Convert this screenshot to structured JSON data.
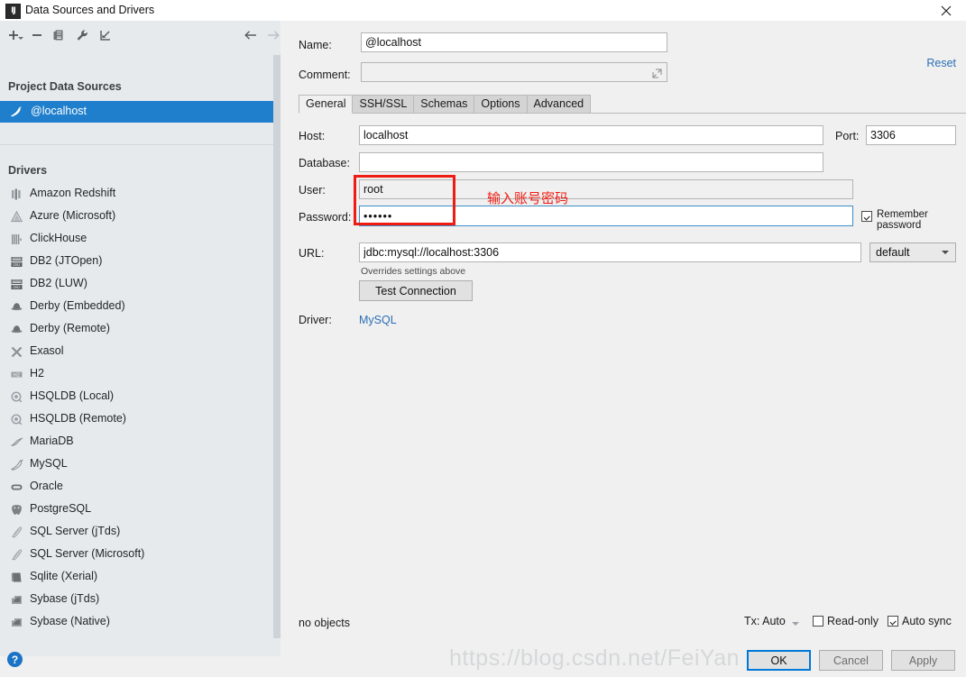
{
  "window": {
    "title": "Data Sources and Drivers",
    "icon": "intellij-idea-icon",
    "logo_text": "IJ",
    "close_label": "✕"
  },
  "toolbar": {
    "add": "add-icon",
    "remove": "remove-icon",
    "copy": "copy-icon",
    "settings": "wrench-icon",
    "import": "import-icon",
    "back": "arrow-left-icon",
    "forward": "arrow-right-icon"
  },
  "sidebar": {
    "project_group_label": "Project Data Sources",
    "datasources": [
      {
        "label": "@localhost",
        "icon": "mysql-icon",
        "selected": true
      }
    ],
    "drivers_group_label": "Drivers",
    "drivers": [
      {
        "label": "Amazon Redshift",
        "icon": "redshift-icon"
      },
      {
        "label": "Azure (Microsoft)",
        "icon": "azure-icon"
      },
      {
        "label": "ClickHouse",
        "icon": "clickhouse-icon"
      },
      {
        "label": "DB2 (JTOpen)",
        "icon": "db2-icon"
      },
      {
        "label": "DB2 (LUW)",
        "icon": "db2-icon"
      },
      {
        "label": "Derby (Embedded)",
        "icon": "derby-icon"
      },
      {
        "label": "Derby (Remote)",
        "icon": "derby-icon"
      },
      {
        "label": "Exasol",
        "icon": "exasol-icon"
      },
      {
        "label": "H2",
        "icon": "h2-icon"
      },
      {
        "label": "HSQLDB (Local)",
        "icon": "hsqldb-icon"
      },
      {
        "label": "HSQLDB (Remote)",
        "icon": "hsqldb-icon"
      },
      {
        "label": "MariaDB",
        "icon": "mariadb-icon"
      },
      {
        "label": "MySQL",
        "icon": "mysql-icon"
      },
      {
        "label": "Oracle",
        "icon": "oracle-icon"
      },
      {
        "label": "PostgreSQL",
        "icon": "postgresql-icon"
      },
      {
        "label": "SQL Server (jTds)",
        "icon": "sqlserver-icon"
      },
      {
        "label": "SQL Server (Microsoft)",
        "icon": "sqlserver-icon"
      },
      {
        "label": "Sqlite (Xerial)",
        "icon": "sqlite-icon"
      },
      {
        "label": "Sybase (jTds)",
        "icon": "sybase-icon"
      },
      {
        "label": "Sybase (Native)",
        "icon": "sybase-icon"
      }
    ]
  },
  "form": {
    "name_label": "Name:",
    "name_value": "@localhost",
    "comment_label": "Comment:",
    "comment_value": "",
    "reset_label": "Reset",
    "expand_icon": "expand-icon"
  },
  "tabs": [
    {
      "label": "General",
      "active": true
    },
    {
      "label": "SSH/SSL",
      "active": false
    },
    {
      "label": "Schemas",
      "active": false
    },
    {
      "label": "Options",
      "active": false
    },
    {
      "label": "Advanced",
      "active": false
    }
  ],
  "general": {
    "host_label": "Host:",
    "host_value": "localhost",
    "port_label": "Port:",
    "port_value": "3306",
    "database_label": "Database:",
    "database_value": "",
    "user_label": "User:",
    "user_value": "root",
    "password_label": "Password:",
    "password_value": "••••••",
    "remember_password_label": "Remember password",
    "remember_password_checked": true,
    "url_label": "URL:",
    "url_value": "jdbc:mysql://localhost:3306",
    "url_mode_value": "default",
    "overrides_hint": "Overrides settings above",
    "test_connection_label": "Test Connection",
    "driver_label": "Driver:",
    "driver_value": "MySQL"
  },
  "status": {
    "objects_text": "no objects",
    "tx_label": "Tx: Auto",
    "readonly_label": "Read-only",
    "readonly_checked": false,
    "autosync_label": "Auto sync",
    "autosync_checked": true
  },
  "footer": {
    "help_label": "?",
    "ok_label": "OK",
    "cancel_label": "Cancel",
    "apply_label": "Apply"
  },
  "annotation": {
    "text": "输入账号密码",
    "color": "#ee1c12"
  },
  "watermark": {
    "text": "https://blog.csdn.net/FeiYan"
  },
  "colors": {
    "selection": "#1f7fcc",
    "link": "#2a6fb5",
    "accent": "#0078d7",
    "annotation": "#ee1c12",
    "panel": "#f0f0f0",
    "sidebar": "#e6eaed"
  }
}
